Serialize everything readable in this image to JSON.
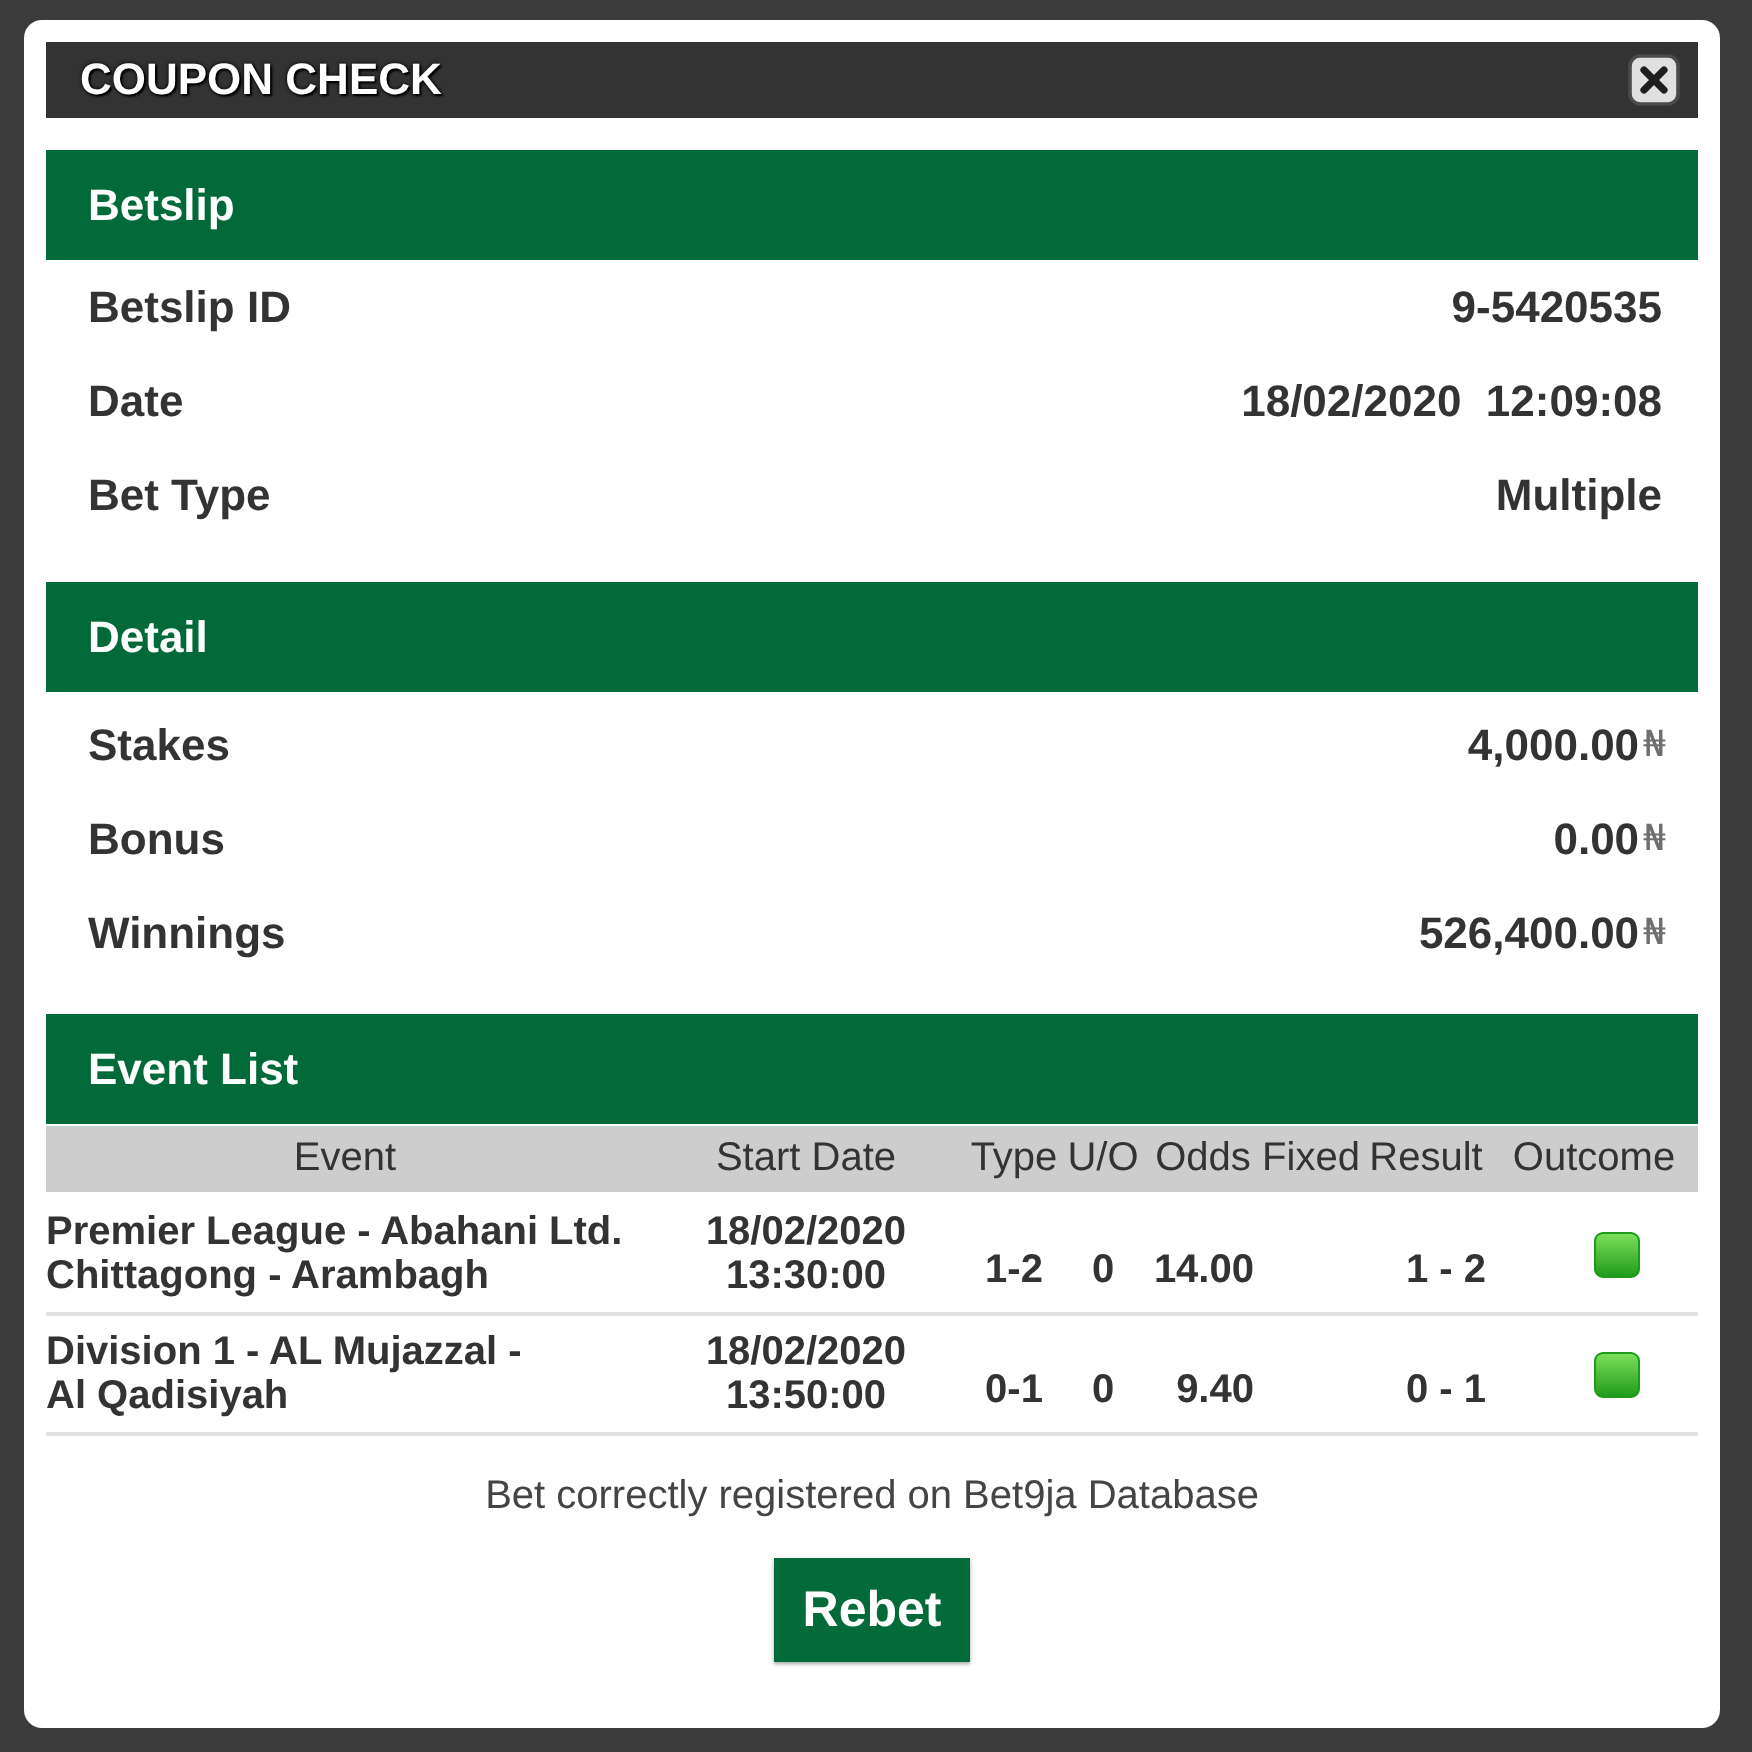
{
  "dialog": {
    "title": "COUPON CHECK"
  },
  "betslip": {
    "heading": "Betslip",
    "rows": [
      {
        "label": "Betslip ID",
        "value": "9-5420535"
      },
      {
        "label": "Date",
        "value": "18/02/2020  12:09:08"
      },
      {
        "label": "Bet Type",
        "value": "Multiple"
      }
    ]
  },
  "detail": {
    "heading": "Detail",
    "rows": [
      {
        "label": "Stakes",
        "value": "4,000.00",
        "currency": "₦"
      },
      {
        "label": "Bonus",
        "value": "0.00",
        "currency": "₦"
      },
      {
        "label": "Winnings",
        "value": "526,400.00",
        "currency": "₦"
      }
    ]
  },
  "event_list": {
    "heading": "Event List",
    "columns": [
      "Event",
      "Start Date",
      "Type",
      "U/O",
      "Odds",
      "Fixed",
      "Result",
      "Outcome"
    ],
    "rows": [
      {
        "event_lines": [
          "Premier League - Abahani Ltd.",
          "Chittagong - Arambagh"
        ],
        "start_date": "18/02/2020 13:30:00",
        "type": "1-2",
        "uo": "0",
        "odds": "14.00",
        "result": "1 - 2",
        "won": true
      },
      {
        "event_lines": [
          "Division 1 - AL Mujazzal -",
          "Al Qadisiyah"
        ],
        "start_date": "18/02/2020 13:50:00",
        "type": "0-1",
        "uo": "0",
        "odds": "9.40",
        "result": "0 - 1",
        "won": true
      }
    ]
  },
  "footer": {
    "message": "Bet correctly registered on Bet9ja Database",
    "button": "Rebet"
  }
}
